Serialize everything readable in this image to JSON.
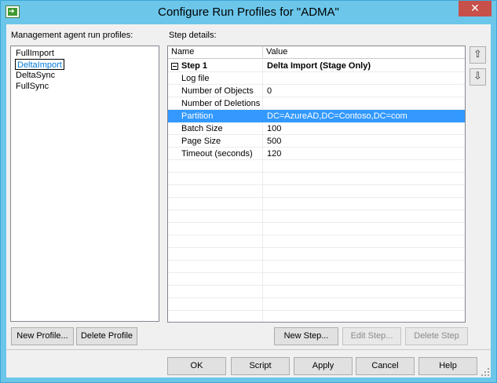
{
  "window": {
    "title": "Configure Run Profiles for \"ADMA\"",
    "close_glyph": "✕"
  },
  "profiles": {
    "label": "Management agent run profiles:",
    "items": [
      {
        "label": "FullImport",
        "selected": false
      },
      {
        "label": "DeltaImport",
        "selected": true
      },
      {
        "label": "DeltaSync",
        "selected": false
      },
      {
        "label": "FullSync",
        "selected": false
      }
    ],
    "new_profile_label": "New Profile...",
    "delete_profile_label": "Delete Profile"
  },
  "steps": {
    "label": "Step details:",
    "columns": [
      "Name",
      "Value"
    ],
    "rows": [
      {
        "name": "Step 1",
        "value": "Delta Import (Stage Only)",
        "bold": true,
        "expander": true,
        "highlight": false
      },
      {
        "name": "Log file",
        "value": "",
        "bold": false,
        "expander": false,
        "highlight": false
      },
      {
        "name": "Number of Objects",
        "value": "0",
        "bold": false,
        "expander": false,
        "highlight": false
      },
      {
        "name": "Number of Deletions",
        "value": "",
        "bold": false,
        "expander": false,
        "highlight": false
      },
      {
        "name": "Partition",
        "value": "DC=AzureAD,DC=Contoso,DC=com",
        "bold": false,
        "expander": false,
        "highlight": true
      },
      {
        "name": "Batch Size",
        "value": "100",
        "bold": false,
        "expander": false,
        "highlight": false
      },
      {
        "name": "Page Size",
        "value": "500",
        "bold": false,
        "expander": false,
        "highlight": false
      },
      {
        "name": "Timeout (seconds)",
        "value": "120",
        "bold": false,
        "expander": false,
        "highlight": false
      }
    ],
    "move_up_icon": "⇧",
    "move_down_icon": "⇩",
    "new_step_label": "New Step...",
    "edit_step_label": "Edit Step...",
    "delete_step_label": "Delete Step"
  },
  "footer": {
    "ok_label": "OK",
    "script_label": "Script",
    "apply_label": "Apply",
    "cancel_label": "Cancel",
    "help_label": "Help"
  },
  "colors": {
    "titlebar": "#6bc6ea",
    "close": "#c7504a",
    "selection": "#3399ff"
  }
}
